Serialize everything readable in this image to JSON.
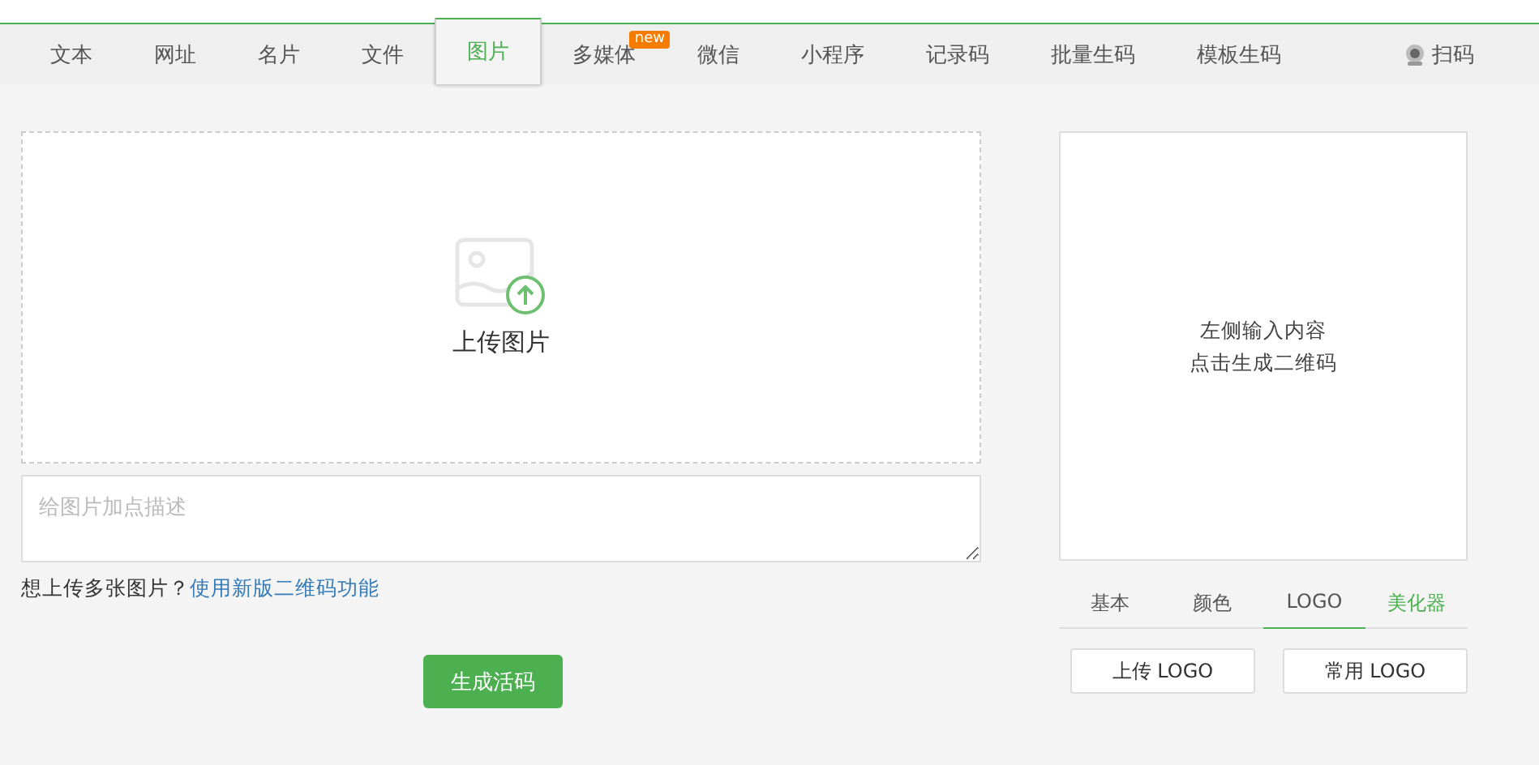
{
  "tabs": [
    {
      "label": "文本",
      "selected": false
    },
    {
      "label": "网址",
      "selected": false
    },
    {
      "label": "名片",
      "selected": false
    },
    {
      "label": "文件",
      "selected": false
    },
    {
      "label": "图片",
      "selected": true
    },
    {
      "label": "多媒体",
      "selected": false,
      "badge": "new"
    },
    {
      "label": "微信",
      "selected": false
    },
    {
      "label": "小程序",
      "selected": false
    },
    {
      "label": "记录码",
      "selected": false
    },
    {
      "label": "批量生码",
      "selected": false
    },
    {
      "label": "模板生码",
      "selected": false
    }
  ],
  "scan": {
    "label": "扫码"
  },
  "upload": {
    "label": "上传图片"
  },
  "description": {
    "placeholder": "给图片加点描述"
  },
  "hint": {
    "text": "想上传多张图片？",
    "link": "使用新版二维码功能"
  },
  "generate_button": "生成活码",
  "preview": {
    "lines": [
      "左侧输入内容",
      "点击生成二维码"
    ]
  },
  "style_tabs": [
    {
      "label": "基本",
      "selected": false,
      "highlight": false
    },
    {
      "label": "颜色",
      "selected": false,
      "highlight": false
    },
    {
      "label": "LOGO",
      "selected": true,
      "highlight": false
    },
    {
      "label": "美化器",
      "selected": false,
      "highlight": true
    }
  ],
  "logo_buttons": [
    "上传 LOGO",
    "常用 LOGO"
  ]
}
